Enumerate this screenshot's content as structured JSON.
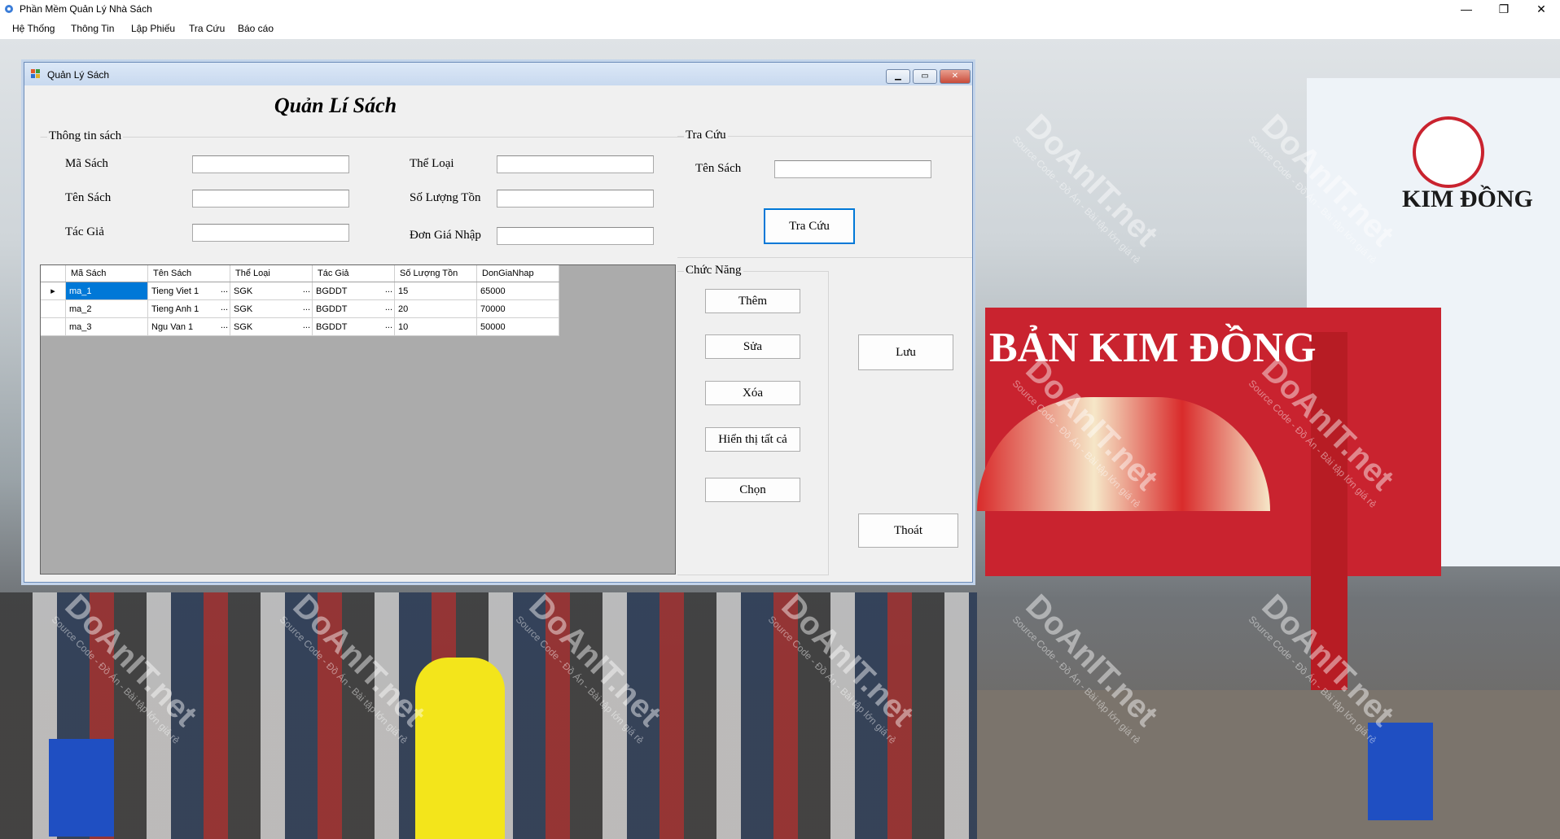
{
  "window": {
    "title": "Phần Mềm Quản Lý Nhà Sách",
    "minimize": "—",
    "restore": "❐",
    "close": "✕"
  },
  "menu": [
    "Hệ Thống",
    "Thông Tin",
    "Lập Phiếu",
    "Tra Cứu",
    "Báo cáo"
  ],
  "background_signs": {
    "brand": "KIM ĐỒNG",
    "booth": "BẢN KIM ĐỒNG"
  },
  "watermark": {
    "main": "DoAnIT.net",
    "sub": "Source Code - Đồ Án - Bài tập lớn giá rẻ"
  },
  "form": {
    "title": "Quản Lý Sách",
    "heading": "Quản Lí Sách",
    "info_group": "Thông tin sách",
    "fields": {
      "ma_sach": {
        "label": "Mã Sách",
        "value": ""
      },
      "ten_sach": {
        "label": "Tên Sách",
        "value": ""
      },
      "tac_gia": {
        "label": "Tác Giả",
        "value": ""
      },
      "the_loai": {
        "label": "Thể Loại",
        "value": ""
      },
      "so_luong_ton": {
        "label": "Số Lượng Tồn",
        "value": ""
      },
      "don_gia_nhap": {
        "label": "Đơn Giá Nhập",
        "value": ""
      }
    },
    "search_group": "Tra Cứu",
    "search_label": "Tên Sách",
    "search_value": "",
    "search_button": "Tra Cứu",
    "func_group": "Chức Năng",
    "buttons": {
      "them": "Thêm",
      "sua": "Sửa",
      "xoa": "Xóa",
      "hien_thi": "Hiển thị tất cả",
      "chon": "Chọn",
      "luu": "Lưu",
      "thoat": "Thoát"
    },
    "grid": {
      "columns": [
        "Mã Sách",
        "Tên Sách",
        "Thể Loại",
        "Tác Giả",
        "Số Lượng Tồn",
        "DonGiaNhap"
      ],
      "rows": [
        [
          "ma_1",
          "Tieng Viet 1",
          "SGK",
          "BGDDT",
          "15",
          "65000"
        ],
        [
          "ma_2",
          "Tieng Anh 1",
          "SGK",
          "BGDDT",
          "20",
          "70000"
        ],
        [
          "ma_3",
          "Ngu Van 1",
          "SGK",
          "BGDDT",
          "10",
          "50000"
        ]
      ],
      "ellipsis": "...",
      "current_row_marker": "▸"
    }
  }
}
